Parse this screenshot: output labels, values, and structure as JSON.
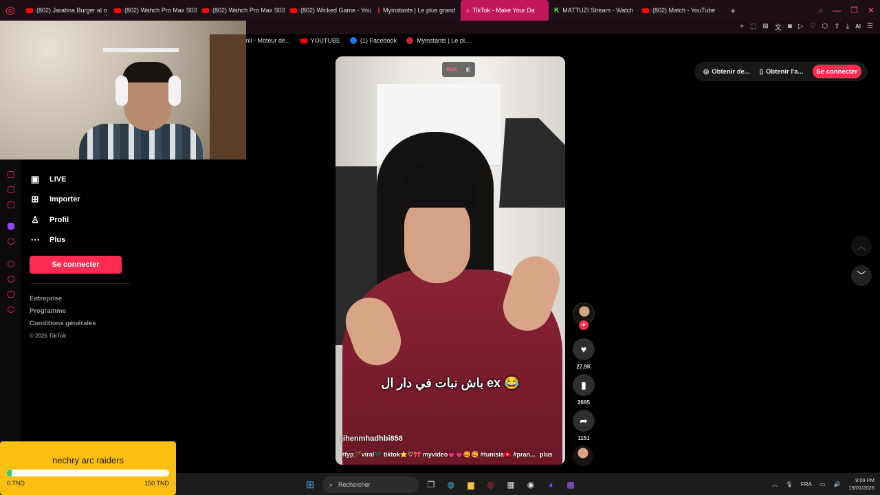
{
  "browser": {
    "tabs": [
      {
        "label": "(802) Jarabna Burger al o",
        "icon": "youtube-icon"
      },
      {
        "label": "(802) Wahch Pro Max S03",
        "icon": "youtube-icon"
      },
      {
        "label": "(802) Wahch Pro Max S03",
        "icon": "youtube-icon"
      },
      {
        "label": "(802) Wicked Game - You",
        "icon": "youtube-icon"
      },
      {
        "label": "Myinstants | Le plus grand",
        "icon": "myinstants-icon"
      },
      {
        "label": "TikTok - Make Your Da",
        "icon": "tiktok-icon",
        "active": true
      },
      {
        "label": "MATTUZI Stream - Watch",
        "icon": "kick-icon"
      },
      {
        "label": "(802) Match - YouTube",
        "icon": "youtube-icon"
      }
    ],
    "bookmarks": [
      {
        "label": "mli - Moteur de..."
      },
      {
        "label": "YOUTUBE"
      },
      {
        "label": "(1) Facebook"
      },
      {
        "label": "Myinstants | Le pl..."
      }
    ],
    "ai_label": "AI"
  },
  "sidebar": {
    "items": [
      {
        "label": "LIVE",
        "icon": "live-icon"
      },
      {
        "label": "Importer",
        "icon": "upload-icon"
      },
      {
        "label": "Profil",
        "icon": "profile-icon"
      },
      {
        "label": "Plus",
        "icon": "more-icon"
      }
    ],
    "login_label": "Se connecter",
    "footer": [
      "Entreprise",
      "Programme",
      "Conditions générales"
    ],
    "copyright": "© 2026 TikTok"
  },
  "video": {
    "badge": "RGX",
    "caption": "باش نبات في دار ال ex 😂",
    "author": "jihenmhadhbi858",
    "tags": "#fyp🪄viral🖤 tiktok⭐♡🎀 myvideo💗💗🥰🥰 #tunisia🇹🇳 #pran...",
    "more_label": "plus"
  },
  "actions": {
    "likes": "27.9K",
    "saves": "2695",
    "shares": "1151"
  },
  "top_right": {
    "item1": "Obtenir de...",
    "item2": "Obtenir l'a...",
    "login": "Se connecter"
  },
  "donation": {
    "title": "nechry arc raiders",
    "min": "0 TND",
    "max": "150 TND",
    "progress": 0.03,
    "fill_color": "#2ecc71"
  },
  "taskbar": {
    "search_placeholder": "Rechercher",
    "lang": "FRA",
    "time": "9:09 PM",
    "date": "19/01/2026"
  },
  "colors": {
    "accent": "#fe2c55",
    "tab_active": "#c2185b"
  }
}
